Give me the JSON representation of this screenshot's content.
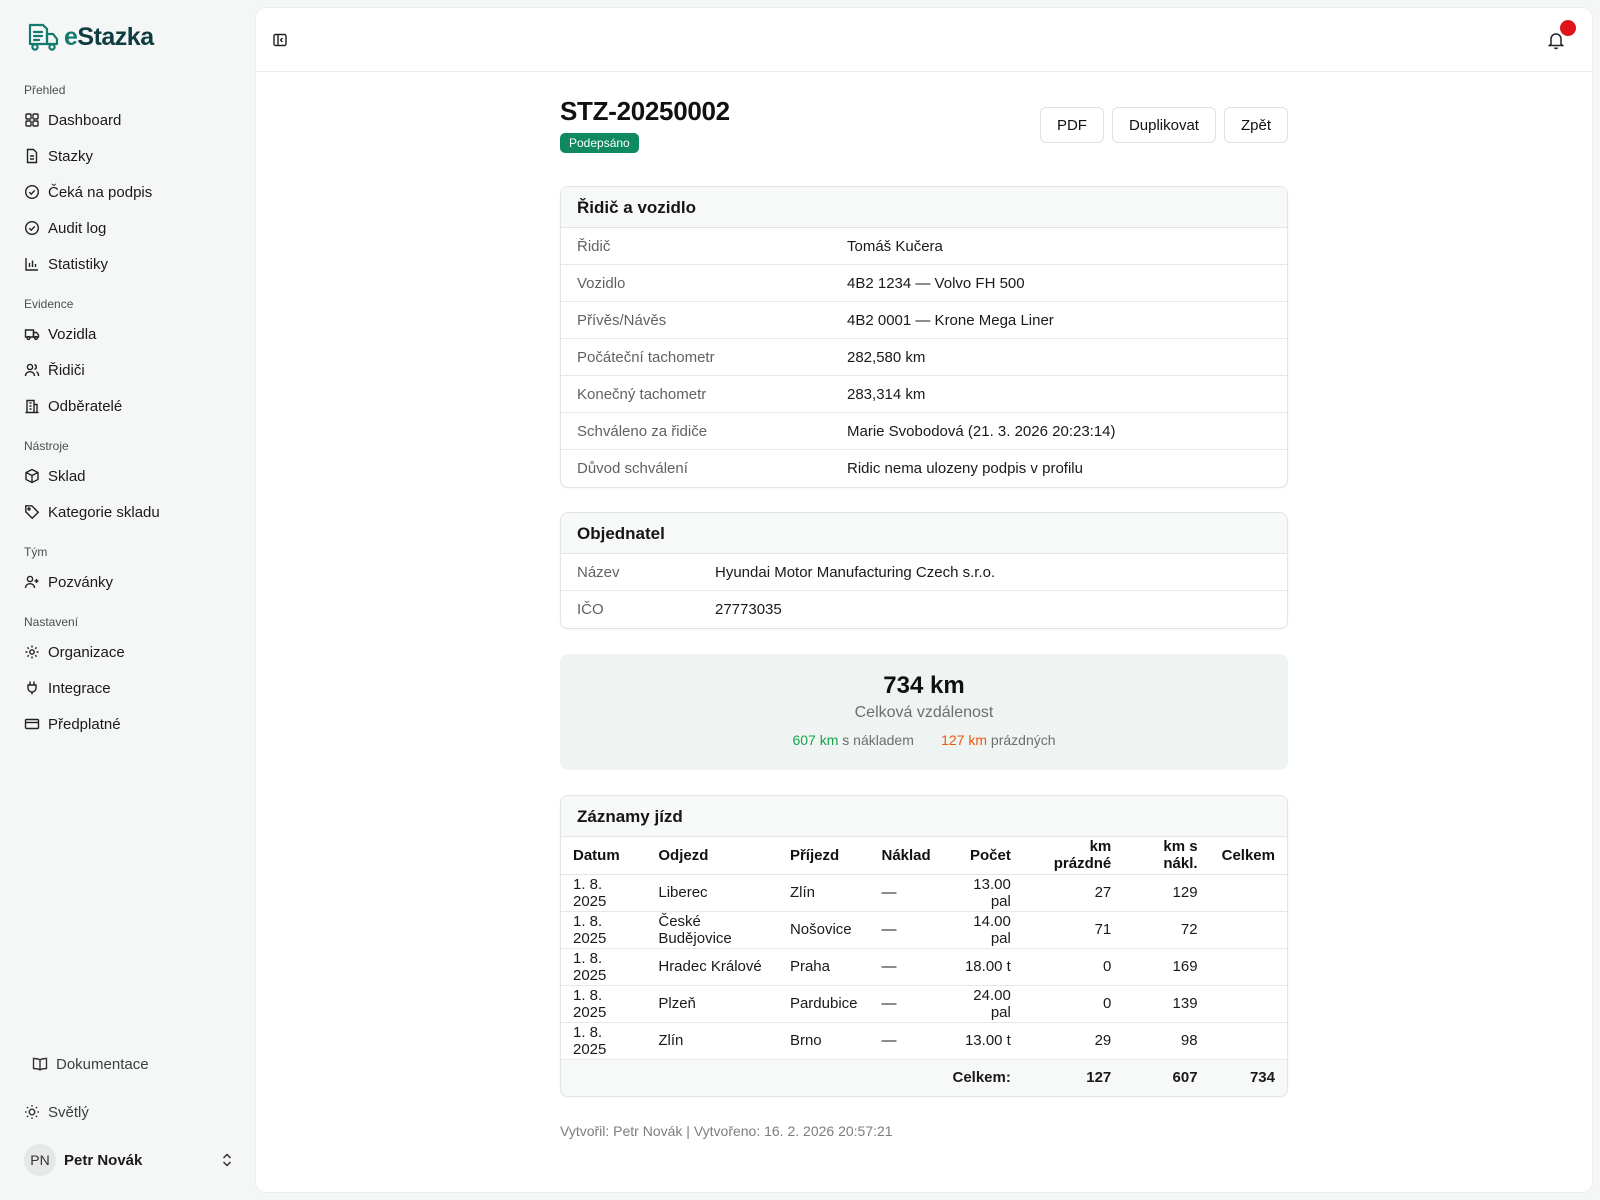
{
  "app": {
    "name_prefix": "e",
    "name_suffix": "Stazka"
  },
  "sidebar": {
    "groups": [
      {
        "label": "Přehled",
        "items": [
          {
            "label": "Dashboard",
            "icon": "grid-icon"
          },
          {
            "label": "Stazky",
            "icon": "document-icon"
          },
          {
            "label": "Čeká na podpis",
            "icon": "check-circle-icon"
          },
          {
            "label": "Audit log",
            "icon": "check-circle-icon"
          },
          {
            "label": "Statistiky",
            "icon": "bar-chart-icon"
          }
        ]
      },
      {
        "label": "Evidence",
        "items": [
          {
            "label": "Vozidla",
            "icon": "truck-icon"
          },
          {
            "label": "Řidiči",
            "icon": "users-icon"
          },
          {
            "label": "Odběratelé",
            "icon": "building-icon"
          }
        ]
      },
      {
        "label": "Nástroje",
        "items": [
          {
            "label": "Sklad",
            "icon": "box-icon"
          },
          {
            "label": "Kategorie skladu",
            "icon": "tag-icon"
          }
        ]
      },
      {
        "label": "Tým",
        "items": [
          {
            "label": "Pozvánky",
            "icon": "user-plus-icon"
          }
        ]
      },
      {
        "label": "Nastavení",
        "items": [
          {
            "label": "Organizace",
            "icon": "gear-icon"
          },
          {
            "label": "Integrace",
            "icon": "plug-icon"
          },
          {
            "label": "Předplatné",
            "icon": "credit-card-icon"
          }
        ]
      }
    ],
    "docs_label": "Dokumentace",
    "theme_label": "Světlý",
    "user": {
      "initials": "PN",
      "name": "Petr Novák"
    }
  },
  "header": {
    "title": "STZ-20250002",
    "status": "Podepsáno",
    "buttons": {
      "pdf": "PDF",
      "duplicate": "Duplikovat",
      "back": "Zpět"
    }
  },
  "driver_card": {
    "title": "Řidič a vozidlo",
    "rows": [
      {
        "label": "Řidič",
        "value": "Tomáš Kučera"
      },
      {
        "label": "Vozidlo",
        "value": "4B2 1234 — Volvo FH 500"
      },
      {
        "label": "Přívěs/Návěs",
        "value": "4B2 0001 — Krone Mega Liner"
      },
      {
        "label": "Počáteční tachometr",
        "value": "282,580 km"
      },
      {
        "label": "Konečný tachometr",
        "value": "283,314 km"
      },
      {
        "label": "Schváleno za řidiče",
        "value": "Marie Svobodová (21. 3. 2026 20:23:14)"
      },
      {
        "label": "Důvod schválení",
        "value": "Ridic nema ulozeny podpis v profilu"
      }
    ]
  },
  "customer_card": {
    "title": "Objednatel",
    "rows": [
      {
        "label": "Název",
        "value": "Hyundai Motor Manufacturing Czech s.r.o."
      },
      {
        "label": "IČO",
        "value": "27773035"
      }
    ]
  },
  "summary": {
    "total": "734 km",
    "total_label": "Celková vzdálenost",
    "loaded_value": "607 km",
    "loaded_label": "s nákladem",
    "empty_value": "127 km",
    "empty_label": "prázdných",
    "loaded_color": "#17a34a",
    "empty_color": "#ea580c"
  },
  "trips": {
    "title": "Záznamy jízd",
    "columns": [
      "Datum",
      "Odjezd",
      "Příjezd",
      "Náklad",
      "Počet",
      "km prázdné",
      "km s nákl.",
      "Celkem"
    ],
    "rows": [
      [
        "1. 8. 2025",
        "Liberec",
        "Zlín",
        "—",
        "13.00 pal",
        "27",
        "129",
        ""
      ],
      [
        "1. 8. 2025",
        "České Budějovice",
        "Nošovice",
        "—",
        "14.00 pal",
        "71",
        "72",
        ""
      ],
      [
        "1. 8. 2025",
        "Hradec Králové",
        "Praha",
        "—",
        "18.00 t",
        "0",
        "169",
        ""
      ],
      [
        "1. 8. 2025",
        "Plzeň",
        "Pardubice",
        "—",
        "24.00 pal",
        "0",
        "139",
        ""
      ],
      [
        "1. 8. 2025",
        "Zlín",
        "Brno",
        "—",
        "13.00 t",
        "29",
        "98",
        ""
      ]
    ],
    "totals": {
      "label": "Celkem:",
      "empty": "127",
      "loaded": "607",
      "total": "734"
    }
  },
  "footer": {
    "meta": "Vytvořil: Petr Novák | Vytvořeno: 16. 2. 2026 20:57:21"
  },
  "colors": {
    "accent": "#137a6e",
    "badge": "#0f8a5f",
    "notification": "#e0131a"
  }
}
